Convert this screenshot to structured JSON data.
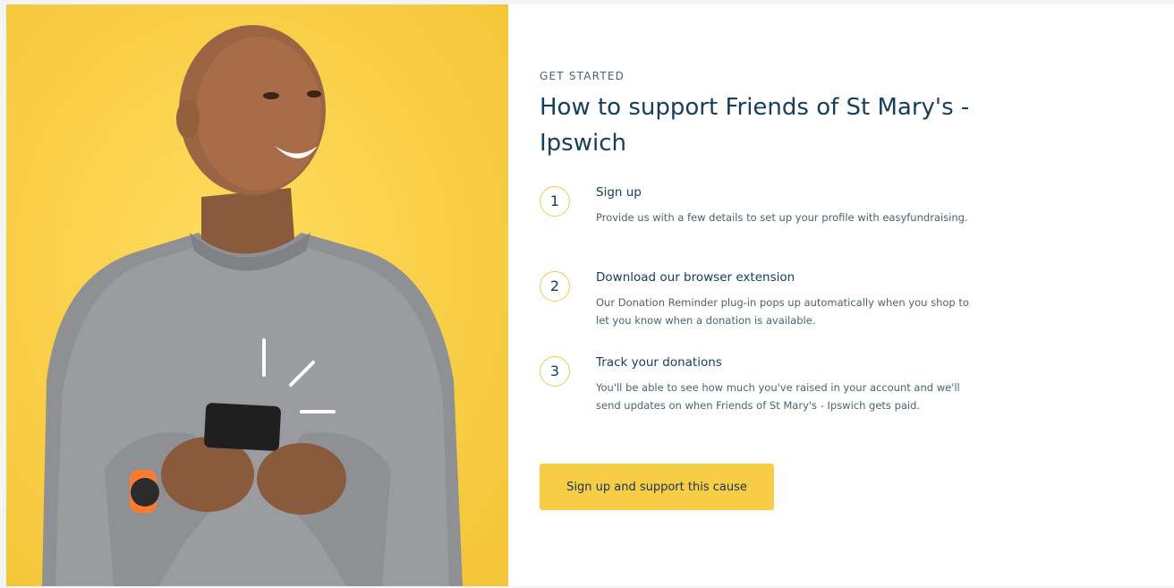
{
  "section": {
    "eyebrow": "GET STARTED",
    "heading": "How to support Friends of St Mary's - Ipswich"
  },
  "steps": [
    {
      "number": "1",
      "title": "Sign up",
      "description": "Provide us with a few details to set up your profile with easyfundraising."
    },
    {
      "number": "2",
      "title": "Download our browser extension",
      "description": "Our Donation Reminder plug-in pops up automatically when you shop to let you know when a donation is available."
    },
    {
      "number": "3",
      "title": "Track your donations",
      "description": "You'll be able to see how much you've raised in your account and we'll send updates on when Friends of St Mary's - Ipswich gets paid."
    }
  ],
  "cta": {
    "label": "Sign up and support this cause"
  },
  "colors": {
    "hero_background": "#ffd24a",
    "accent": "#f8cd46",
    "heading": "#16405a",
    "body_text": "#4b6374",
    "step_ring": "#f2c94c"
  },
  "hero": {
    "icon": "person-with-phone-illustration"
  }
}
